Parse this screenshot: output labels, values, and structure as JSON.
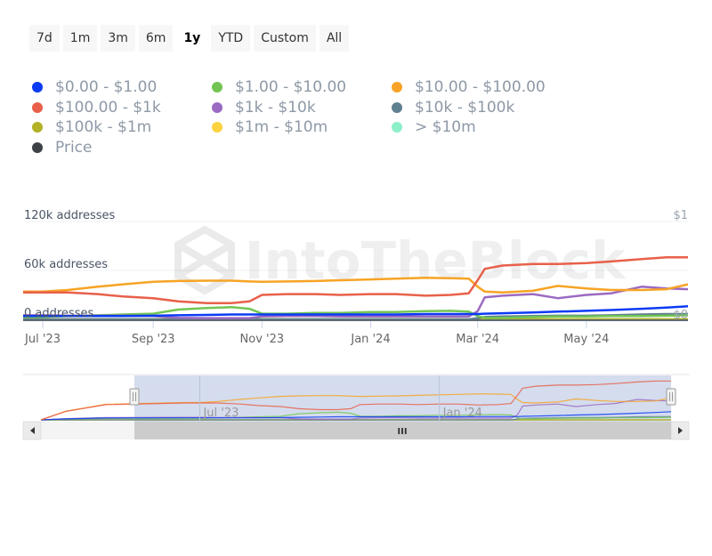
{
  "range_selector": {
    "buttons": [
      "7d",
      "1m",
      "3m",
      "6m",
      "1y",
      "YTD",
      "Custom",
      "All"
    ],
    "active": "1y"
  },
  "legend": [
    {
      "label": "$0.00 - $1.00",
      "color": "#0b3bf5"
    },
    {
      "label": "$1.00 - $10.00",
      "color": "#72c553"
    },
    {
      "label": "$10.00 - $100.00",
      "color": "#f7a325"
    },
    {
      "label": "$100.00 - $1k",
      "color": "#e8604a"
    },
    {
      "label": "$1k - $10k",
      "color": "#9b6ac2"
    },
    {
      "label": "$10k - $100k",
      "color": "#5f8091"
    },
    {
      "label": "$100k - $1m",
      "color": "#b3b126"
    },
    {
      "label": "$1m - $10m",
      "color": "#fcd23e"
    },
    {
      "label": "> $10m",
      "color": "#8cefc8"
    },
    {
      "label": "Price",
      "color": "#3d4248"
    }
  ],
  "watermark": "IntoTheBlock",
  "navigator": {
    "labels": [
      "Jul '23",
      "Jan '24"
    ],
    "scroll_grip": "III"
  },
  "chart_data": {
    "type": "line",
    "title": "",
    "xlabel": "",
    "ylabel": "addresses",
    "y_ticks": [
      "0 addresses",
      "60k addresses",
      "120k addresses"
    ],
    "y_right_ticks": [
      "$0",
      "$1"
    ],
    "ylim": [
      0,
      120000
    ],
    "x_ticks": [
      "Jul '23",
      "Sep '23",
      "Nov '23",
      "Jan '24",
      "Mar '24",
      "May '24"
    ],
    "x": [
      "2023-06-20",
      "2023-07-01",
      "2023-07-15",
      "2023-08-01",
      "2023-08-15",
      "2023-09-01",
      "2023-09-15",
      "2023-10-01",
      "2023-10-15",
      "2023-10-25",
      "2023-11-01",
      "2023-11-15",
      "2023-12-01",
      "2023-12-15",
      "2024-01-01",
      "2024-01-15",
      "2024-02-01",
      "2024-02-15",
      "2024-02-25",
      "2024-03-01",
      "2024-03-05",
      "2024-03-15",
      "2024-04-01",
      "2024-04-15",
      "2024-05-01",
      "2024-05-15",
      "2024-06-01",
      "2024-06-15",
      "2024-06-27"
    ],
    "series": [
      {
        "name": "$0.00 - $1.00",
        "values": [
          4000,
          4000,
          4000,
          4000,
          4000,
          4500,
          5000,
          5500,
          6000,
          6000,
          6000,
          6000,
          6000,
          6000,
          6000,
          6000,
          6500,
          6500,
          6500,
          6500,
          7000,
          7500,
          8500,
          9500,
          10500,
          11500,
          13000,
          14500,
          16000
        ]
      },
      {
        "name": "$1.00 - $10.00",
        "values": [
          3000,
          3000,
          4000,
          5000,
          6000,
          7000,
          12000,
          14000,
          15000,
          13000,
          7000,
          7000,
          8000,
          8000,
          9000,
          9000,
          10000,
          10500,
          9500,
          4000,
          2000,
          2000,
          3000,
          3500,
          3500,
          4000,
          4000,
          4500,
          5000
        ]
      },
      {
        "name": "$10.00 - $100.00",
        "values": [
          34000,
          34000,
          36000,
          40000,
          43000,
          46000,
          47000,
          47500,
          47500,
          46500,
          46000,
          46500,
          47000,
          48000,
          49000,
          50000,
          51000,
          50500,
          50000,
          40000,
          34000,
          33000,
          35000,
          41000,
          38000,
          36000,
          36000,
          37000,
          43000
        ]
      },
      {
        "name": "$100.00 - $1k",
        "values": [
          33000,
          33000,
          33000,
          31000,
          28000,
          26000,
          22000,
          20000,
          20000,
          22000,
          30000,
          31000,
          31000,
          30000,
          31000,
          31000,
          29000,
          30000,
          32000,
          48000,
          62000,
          66000,
          68000,
          68000,
          69000,
          71000,
          74000,
          76000,
          76000
        ]
      },
      {
        "name": "$1k - $10k",
        "values": [
          5000,
          5000,
          4500,
          4500,
          4500,
          4000,
          2000,
          1500,
          1500,
          1500,
          3500,
          4000,
          4000,
          3500,
          3500,
          3500,
          3500,
          3500,
          3500,
          10000,
          27000,
          29000,
          31000,
          26000,
          30000,
          32000,
          40000,
          38000,
          37000
        ]
      },
      {
        "name": "$10k - $100k",
        "values": [
          0,
          0,
          0,
          0,
          0,
          0,
          0,
          0,
          0,
          0,
          0,
          0,
          0,
          0,
          0,
          0,
          0,
          0,
          0,
          1500,
          3000,
          3500,
          4000,
          4500,
          4500,
          5000,
          6000,
          6500,
          6500
        ]
      },
      {
        "name": "$100k - $1m",
        "values": [
          0,
          0,
          0,
          0,
          0,
          0,
          0,
          0,
          0,
          0,
          0,
          0,
          0,
          0,
          0,
          0,
          0,
          0,
          0,
          0,
          0,
          0,
          0,
          0,
          0,
          0,
          0,
          0,
          0
        ]
      },
      {
        "name": "$1m - $10m",
        "values": [
          0,
          0,
          0,
          0,
          0,
          0,
          0,
          0,
          0,
          0,
          0,
          0,
          0,
          0,
          0,
          0,
          0,
          0,
          0,
          0,
          0,
          0,
          0,
          0,
          0,
          0,
          0,
          0,
          0
        ]
      },
      {
        "name": "> $10m",
        "values": [
          0,
          0,
          0,
          0,
          0,
          0,
          0,
          0,
          0,
          0,
          0,
          0,
          0,
          0,
          0,
          0,
          0,
          0,
          0,
          0,
          0,
          0,
          0,
          0,
          0,
          0,
          0,
          0,
          0
        ]
      },
      {
        "name": "Price",
        "values": [
          0,
          0,
          0,
          0,
          0,
          0,
          0,
          0,
          0,
          0,
          0,
          0,
          0,
          0,
          0,
          0,
          0,
          0,
          0,
          0,
          0,
          0,
          0,
          0,
          0,
          0,
          0,
          0,
          0
        ]
      }
    ],
    "grid": true,
    "legend_position": "top-left"
  }
}
